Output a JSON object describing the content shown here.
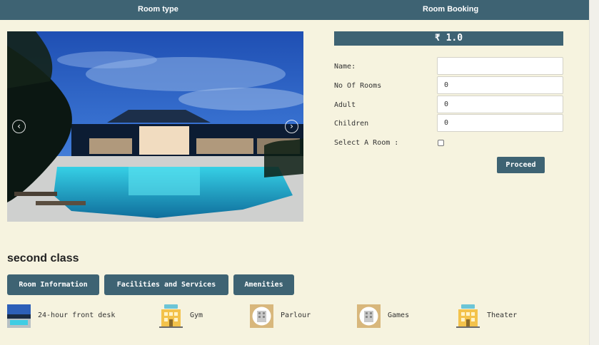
{
  "header": {
    "room_type_label": "Room type",
    "room_booking_label": "Room Booking"
  },
  "slider": {
    "prev_glyph": "‹",
    "next_glyph": "›"
  },
  "booking": {
    "price": "₹ 1.0",
    "fields": {
      "name": {
        "label": "Name:",
        "value": ""
      },
      "rooms": {
        "label": "No Of Rooms",
        "value": "0"
      },
      "adult": {
        "label": "Adult",
        "value": "0"
      },
      "children": {
        "label": "Children",
        "value": "0"
      }
    },
    "select_room_label": "Select A Room :",
    "select_room_checked": false,
    "proceed_label": "Proceed"
  },
  "room": {
    "class_title": "second class",
    "tabs": [
      "Room Information",
      "Facilities and Services",
      "Amenities"
    ]
  },
  "facilities": [
    {
      "label": "24-hour front desk",
      "icon": "resort-photo-icon"
    },
    {
      "label": "Gym",
      "icon": "hotel-building-icon"
    },
    {
      "label": "Parlour",
      "icon": "building-badge-icon"
    },
    {
      "label": "Games",
      "icon": "building-badge-icon"
    },
    {
      "label": "Theater",
      "icon": "hotel-building-icon"
    }
  ],
  "colors": {
    "accent": "#3e6373",
    "background": "#f6f3df",
    "icon_yellow": "#f3c24b",
    "icon_badge": "#d8b77c"
  }
}
